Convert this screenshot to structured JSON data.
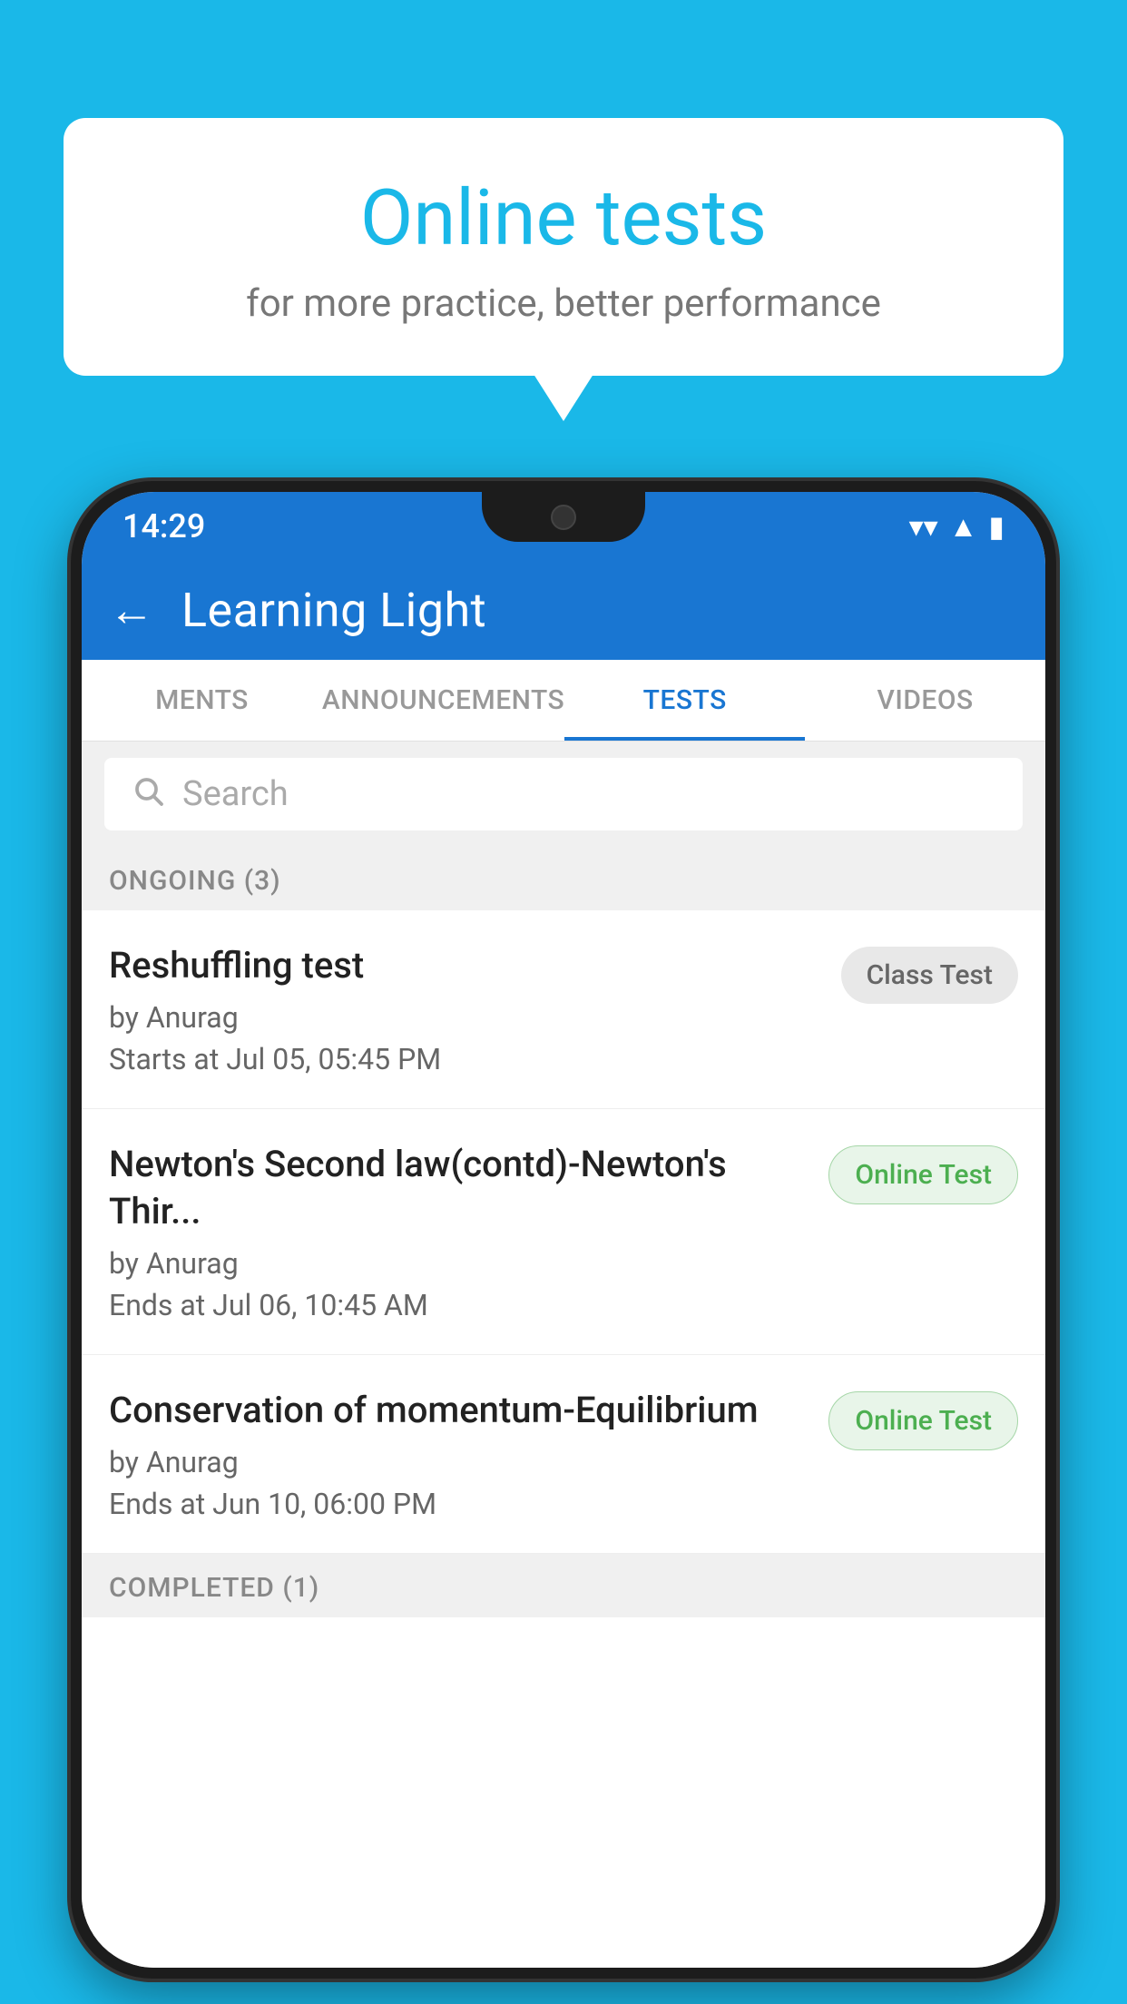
{
  "background": {
    "color": "#1ab8e8"
  },
  "speech_bubble": {
    "title": "Online tests",
    "subtitle": "for more practice, better performance"
  },
  "phone": {
    "status_bar": {
      "time": "14:29",
      "wifi": "▼",
      "signal": "▲",
      "battery": "▮"
    },
    "app_bar": {
      "back_label": "←",
      "title": "Learning Light"
    },
    "tabs": [
      {
        "label": "MENTS",
        "active": false
      },
      {
        "label": "ANNOUNCEMENTS",
        "active": false
      },
      {
        "label": "TESTS",
        "active": true
      },
      {
        "label": "VIDEOS",
        "active": false
      }
    ],
    "search": {
      "placeholder": "Search"
    },
    "ongoing_section": {
      "label": "ONGOING (3)"
    },
    "tests": [
      {
        "name": "Reshuffling test",
        "author": "by Anurag",
        "time_label": "Starts at",
        "time": "Jul 05, 05:45 PM",
        "badge": "Class Test",
        "badge_type": "class"
      },
      {
        "name": "Newton's Second law(contd)-Newton's Thir...",
        "author": "by Anurag",
        "time_label": "Ends at",
        "time": "Jul 06, 10:45 AM",
        "badge": "Online Test",
        "badge_type": "online"
      },
      {
        "name": "Conservation of momentum-Equilibrium",
        "author": "by Anurag",
        "time_label": "Ends at",
        "time": "Jun 10, 06:00 PM",
        "badge": "Online Test",
        "badge_type": "online"
      }
    ],
    "completed_section": {
      "label": "COMPLETED (1)"
    }
  }
}
